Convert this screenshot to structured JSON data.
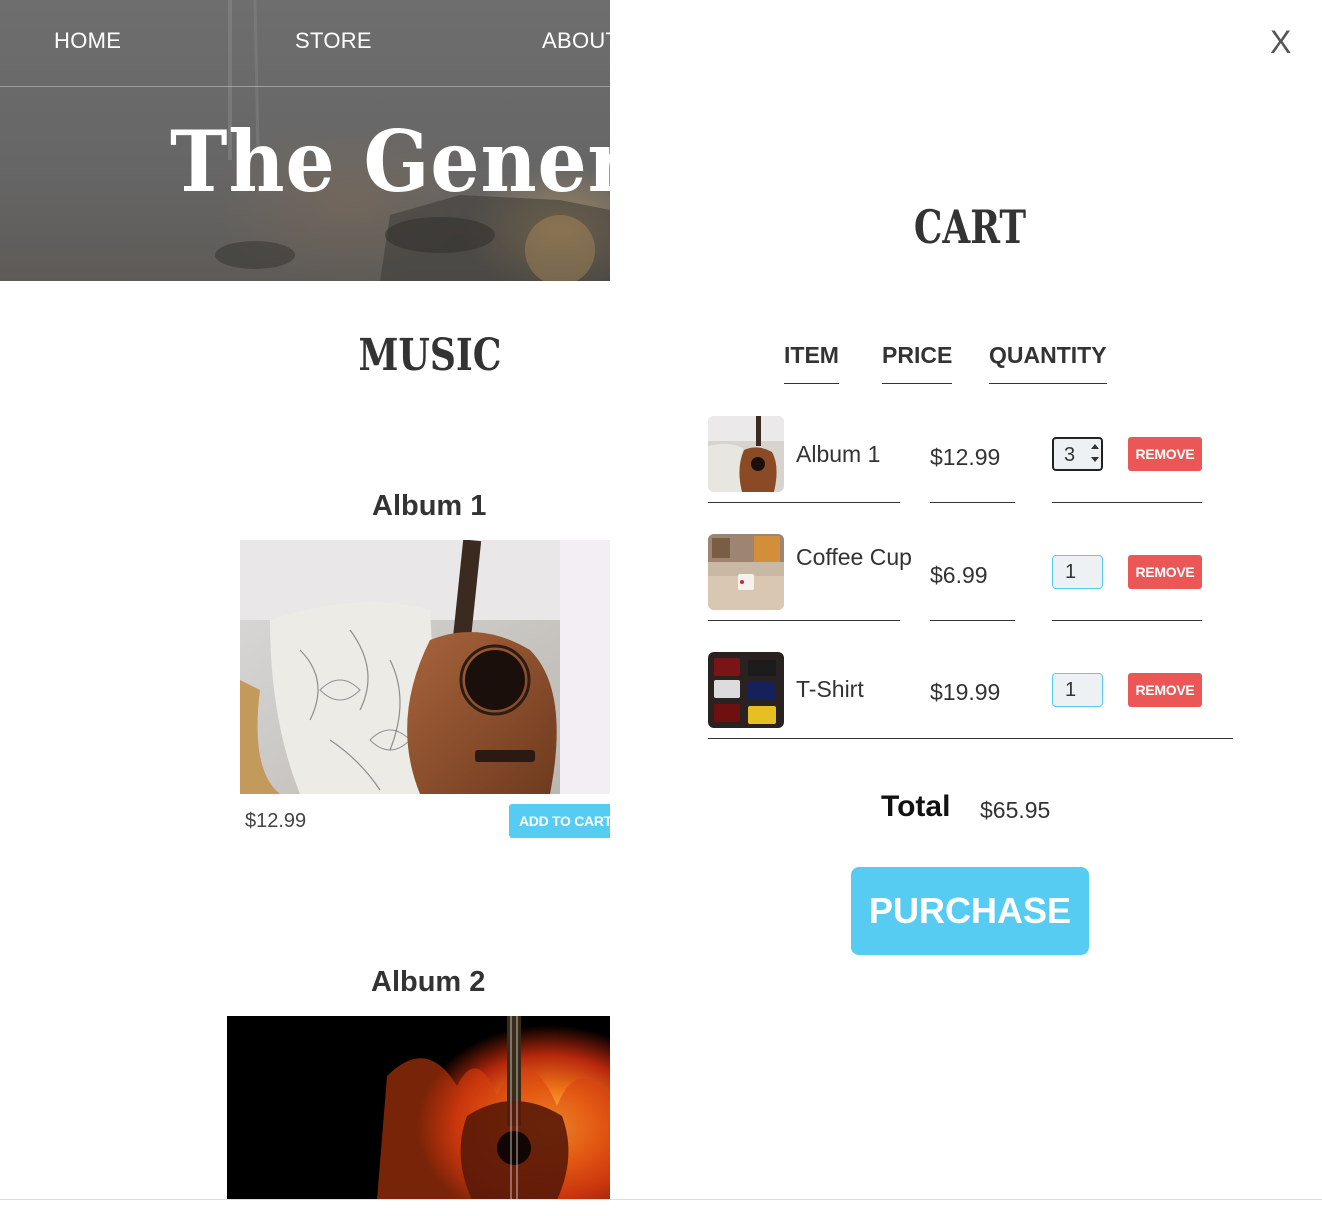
{
  "nav": {
    "home": "HOME",
    "store": "STORE",
    "about": "ABOUT"
  },
  "hero": {
    "band_title": "The Generics"
  },
  "store": {
    "section_title": "MUSIC",
    "albums": [
      {
        "title": "Album 1",
        "price": "$12.99",
        "button": "ADD TO CART"
      },
      {
        "title": "Album 2"
      }
    ]
  },
  "cart": {
    "close_label": "X",
    "title": "CART",
    "columns": {
      "item": "ITEM",
      "price": "PRICE",
      "quantity": "QUANTITY"
    },
    "items": [
      {
        "name": "Album 1",
        "price": "$12.99",
        "quantity": "3",
        "remove": "REMOVE",
        "thumb_icon": "guitar-thumb"
      },
      {
        "name": "Coffee Cup",
        "price": "$6.99",
        "quantity": "1",
        "remove": "REMOVE",
        "thumb_icon": "coffee-cup-thumb"
      },
      {
        "name": "T-Shirt",
        "price": "$19.99",
        "quantity": "1",
        "remove": "REMOVE",
        "thumb_icon": "tshirt-thumb"
      }
    ],
    "total_label": "Total",
    "total_value": "$65.95",
    "purchase": "PURCHASE"
  },
  "colors": {
    "accent_blue": "#56ccf2",
    "remove_red": "#eb5757",
    "text_dark": "#333333"
  }
}
